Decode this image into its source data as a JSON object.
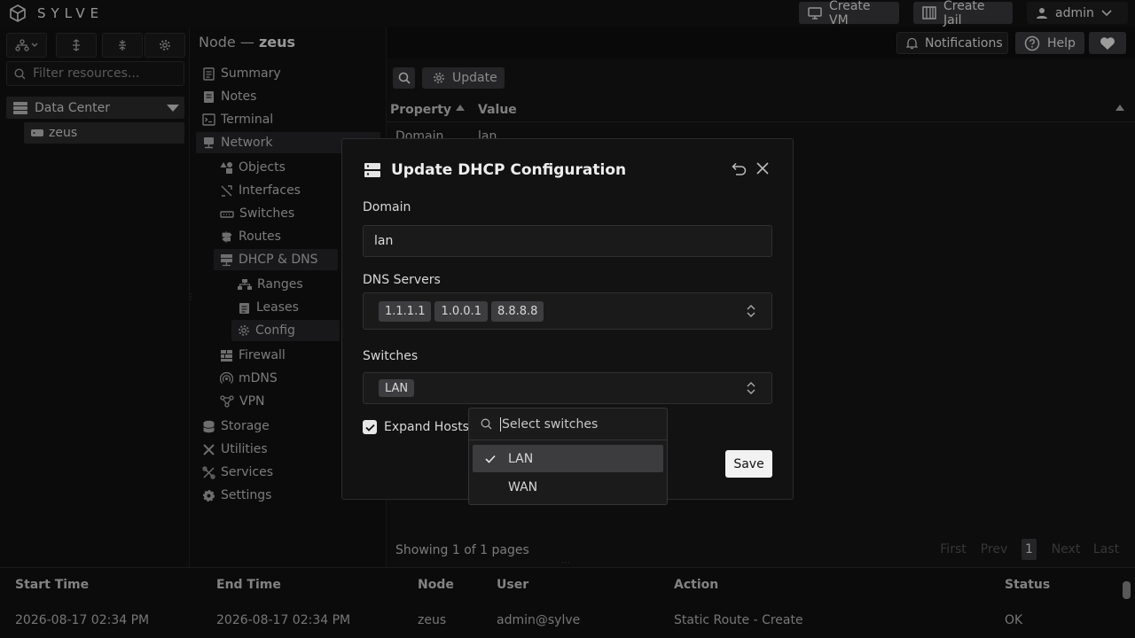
{
  "app": {
    "name": "SYLVE"
  },
  "topbar": {
    "create_vm": "Create VM",
    "create_jail": "Create Jail",
    "user": "admin"
  },
  "sidebar": {
    "filter_placeholder": "Filter resources...",
    "datacenter": "Data Center",
    "node": "zeus"
  },
  "header": {
    "node_prefix": "Node —",
    "node_name": "zeus",
    "notifications": "Notifications",
    "help": "Help"
  },
  "nav": {
    "summary": "Summary",
    "notes": "Notes",
    "terminal": "Terminal",
    "network": "Network",
    "objects": "Objects",
    "interfaces": "Interfaces",
    "switches": "Switches",
    "routes": "Routes",
    "dhcp_dns": "DHCP & DNS",
    "ranges": "Ranges",
    "leases": "Leases",
    "config": "Config",
    "firewall": "Firewall",
    "mdns": "mDNS",
    "vpn": "VPN",
    "storage": "Storage",
    "utilities": "Utilities",
    "services": "Services",
    "settings": "Settings"
  },
  "content": {
    "update_label": "Update",
    "col_property": "Property",
    "col_value": "Value",
    "row1_property": "Domain",
    "row1_value": "lan",
    "showing": "Showing 1 of 1 pages",
    "pager": {
      "first": "First",
      "prev": "Prev",
      "page": "1",
      "next": "Next",
      "last": "Last"
    }
  },
  "dialog": {
    "title": "Update DHCP Configuration",
    "domain_label": "Domain",
    "domain_value": "lan",
    "dns_label": "DNS Servers",
    "dns_servers": [
      "1.1.1.1",
      "1.0.0.1",
      "8.8.8.8"
    ],
    "switches_label": "Switches",
    "switches_selected": [
      "LAN"
    ],
    "expand_hosts_label": "Expand Hosts",
    "expand_hosts_checked": true,
    "save_label": "Save"
  },
  "dropdown": {
    "placeholder": "Select switches",
    "options": [
      {
        "label": "LAN",
        "selected": true
      },
      {
        "label": "WAN",
        "selected": false
      }
    ]
  },
  "tasks": {
    "headers": [
      "Start Time",
      "End Time",
      "Node",
      "User",
      "Action",
      "Status"
    ],
    "rows": [
      [
        "2026-08-17 02:34 PM",
        "2026-08-17 02:34 PM",
        "zeus",
        "admin@sylve",
        "Static Route - Create",
        "OK"
      ]
    ]
  }
}
